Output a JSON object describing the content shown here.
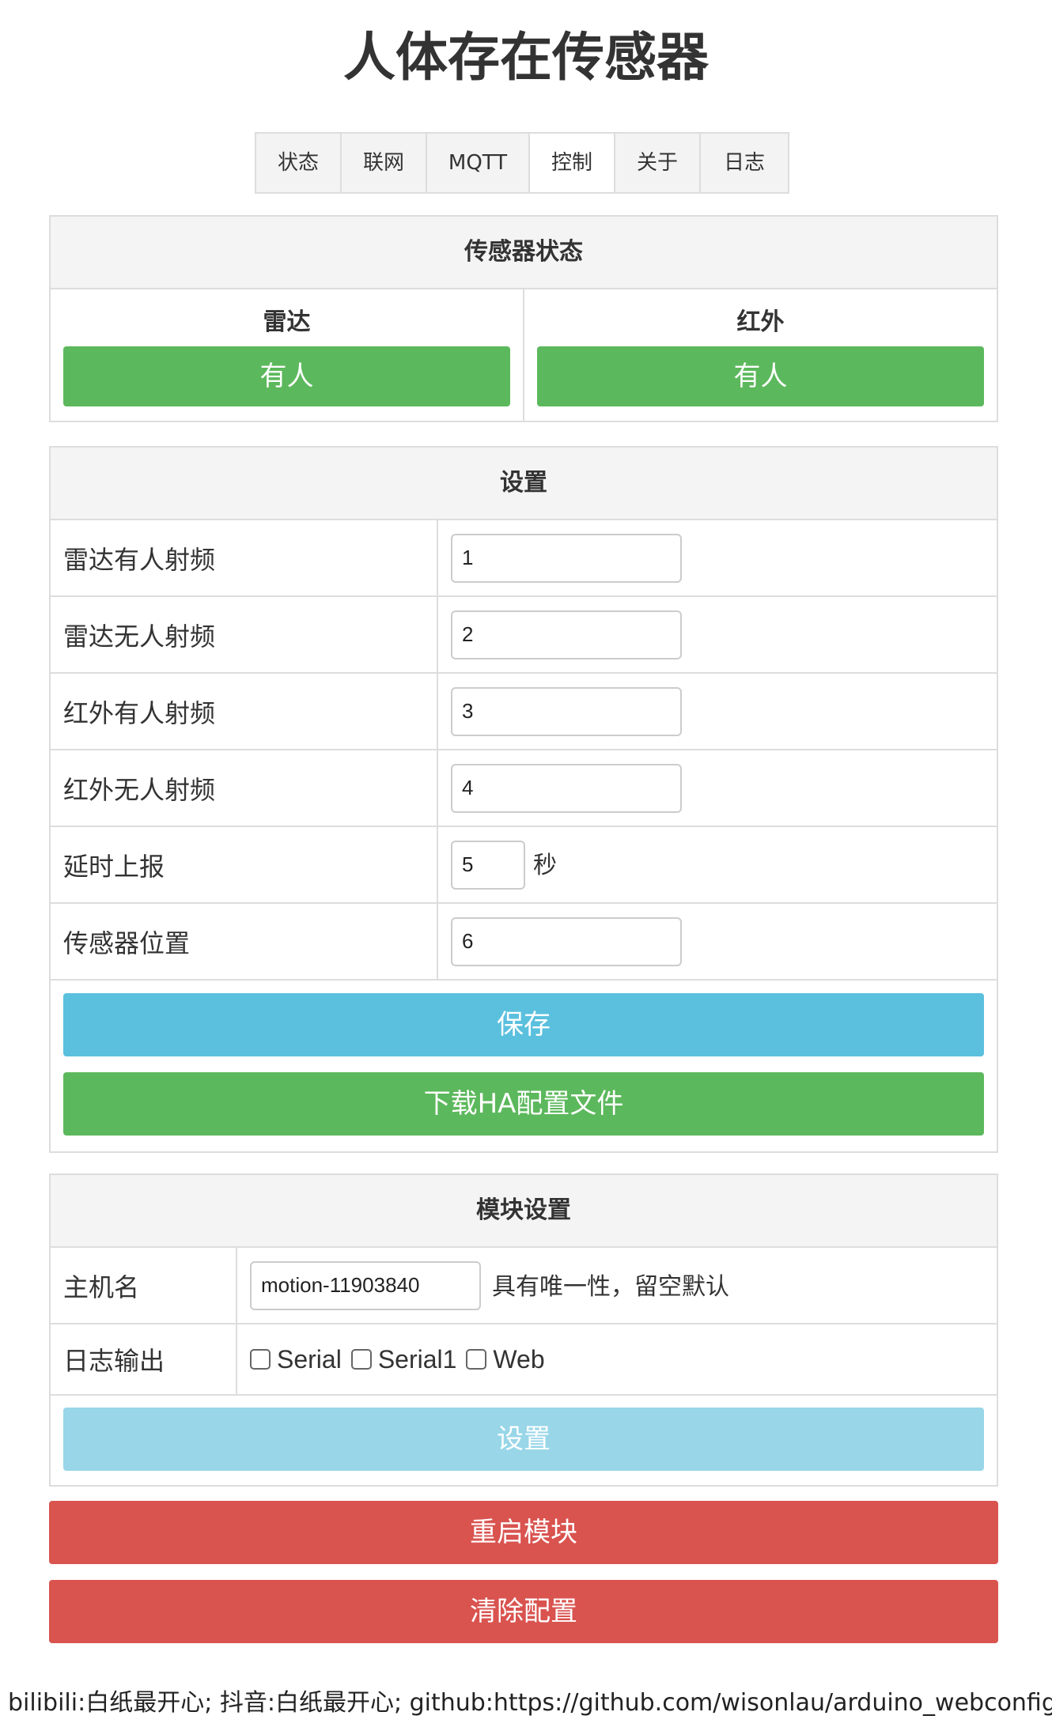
{
  "page_title": "人体存在传感器",
  "tabs": [
    {
      "label": "状态"
    },
    {
      "label": "联网"
    },
    {
      "label": "MQTT"
    },
    {
      "label": "控制"
    },
    {
      "label": "关于"
    },
    {
      "label": "日志"
    }
  ],
  "active_tab": "控制",
  "sensor_panel": {
    "title": "传感器状态",
    "radar": {
      "label": "雷达",
      "status": "有人"
    },
    "infrared": {
      "label": "红外",
      "status": "有人"
    }
  },
  "settings_panel": {
    "title": "设置",
    "rows": [
      {
        "label": "雷达有人射频",
        "value": "1"
      },
      {
        "label": "雷达无人射频",
        "value": "2"
      },
      {
        "label": "红外有人射频",
        "value": "3"
      },
      {
        "label": "红外无人射频",
        "value": "4"
      },
      {
        "label": "延时上报",
        "value": "5",
        "unit": "秒"
      },
      {
        "label": "传感器位置",
        "value": "6"
      }
    ],
    "save_label": "保存",
    "download_label": "下载HA配置文件"
  },
  "module_panel": {
    "title": "模块设置",
    "hostname_label": "主机名",
    "hostname_value": "motion-11903840",
    "hostname_hint": "具有唯一性，留空默认",
    "log_output_label": "日志输出",
    "log_options": [
      {
        "label": "Serial",
        "checked": false
      },
      {
        "label": "Serial1",
        "checked": false
      },
      {
        "label": "Web",
        "checked": false
      }
    ],
    "set_label": "设置"
  },
  "restart_label": "重启模块",
  "clear_label": "清除配置",
  "footer_text": "bilibili:白纸最开心; 抖音:白纸最开心; github:https://github.com/wisonlau/arduino_webconfig",
  "colors": {
    "success": "#5cb85c",
    "info": "#5bc0de",
    "info_disabled": "#98d6e8",
    "danger": "#d9534f",
    "border": "#dddddd",
    "header_bg": "#f4f4f4"
  }
}
